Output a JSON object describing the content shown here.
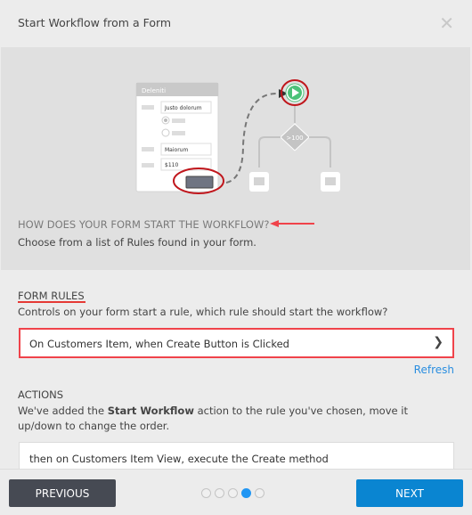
{
  "header": {
    "title": "Start Workflow from a Form",
    "close_icon": "close-icon"
  },
  "illustration": {
    "form_title": "Deleniti",
    "field1": "Justo dolorum",
    "field2": "Maiorum",
    "field3": "$110",
    "decision_label": ">100",
    "highlight_color": "#c0161c",
    "start_color": "#4cc279"
  },
  "intro": {
    "question": "HOW DOES YOUR FORM START THE WORKFLOW?",
    "description": "Choose from a list of Rules found in your form."
  },
  "form_rules": {
    "heading": "FORM RULES",
    "description": "Controls on your form start a rule, which rule should start the workflow?",
    "selected": "On Customers Item, when Create Button is Clicked",
    "refresh": "Refresh"
  },
  "actions": {
    "heading": "ACTIONS",
    "desc_before": "We've added the ",
    "desc_bold": "Start Workflow",
    "desc_after": " action to the rule you've chosen, move it up/down to change the order.",
    "item": "then on Customers Item View, execute the Create method"
  },
  "footer": {
    "previous": "PREVIOUS",
    "next": "NEXT",
    "steps": 5,
    "current_step": 4
  },
  "colors": {
    "accent": "#0a85d1",
    "highlight": "#f0434a",
    "link": "#2a8ee0"
  }
}
